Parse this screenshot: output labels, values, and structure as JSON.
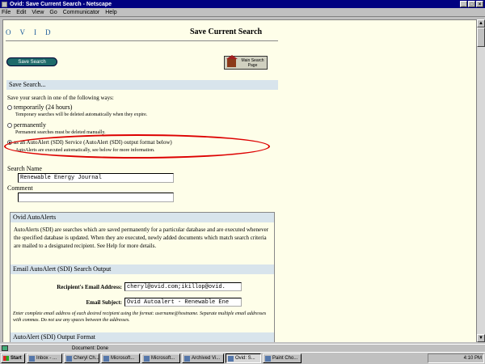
{
  "window": {
    "title": "Ovid: Save Current Search - Netscape"
  },
  "menu": [
    "File",
    "Edit",
    "View",
    "Go",
    "Communicator",
    "Help"
  ],
  "page": {
    "logo": "OVID",
    "title": "Save Current Search",
    "save_button": "Save Search",
    "main_button": "Main Search Page",
    "section_title": "Save Search...",
    "intro": "Save your search in one of the following ways:",
    "options": [
      {
        "label": "temporarily (24 hours)",
        "note": "Temporary searches will be deleted automatically when they expire."
      },
      {
        "label": "permanently",
        "note": "Permanent searches must be deleted manually."
      },
      {
        "label": "as an AutoAlert (SDI) Service (AutoAlert (SDI) output format below)",
        "note": "AutoAlerts are executed automatically, see below for more information."
      }
    ],
    "search_name_label": "Search Name",
    "search_name_value": "Renewable Energy Journal",
    "comment_label": "Comment",
    "comment_value": "",
    "autoalerts_title": "Ovid AutoAlerts",
    "autoalerts_text": "AutoAlerts (SDI) are searches which are saved permanently for a particular database and are executed whenever the specified database is updated. When they are executed, newly added documents which match search criteria are mailed to a designated recipient. See Help for more details.",
    "email_section_title": "Email AutoAlert (SDI) Search Output",
    "recipient_label": "Recipient's Email Address:",
    "recipient_value": "cheryl@ovid.com;ikillop@ovid.",
    "subject_label": "Email Subject:",
    "subject_value": "Ovid Autoalert - Renewable Ene",
    "email_note": "Enter complete email address of each desired recipient using the format: username@hostname. Separate multiple email addresses with commas. Do not use any spaces between the addresses.",
    "output_section_title": "AutoAlert (SDI) Output Format"
  },
  "status": {
    "text": "Document: Done"
  },
  "taskbar": {
    "start": "Start",
    "tasks": [
      "Inbox - ...",
      "Cheryl Ch...",
      "Microsoft...",
      "Microsoft...",
      "Archived Vi...",
      "Ovid: S...",
      "Paint Cho..."
    ],
    "clock": "4:10 PM"
  }
}
